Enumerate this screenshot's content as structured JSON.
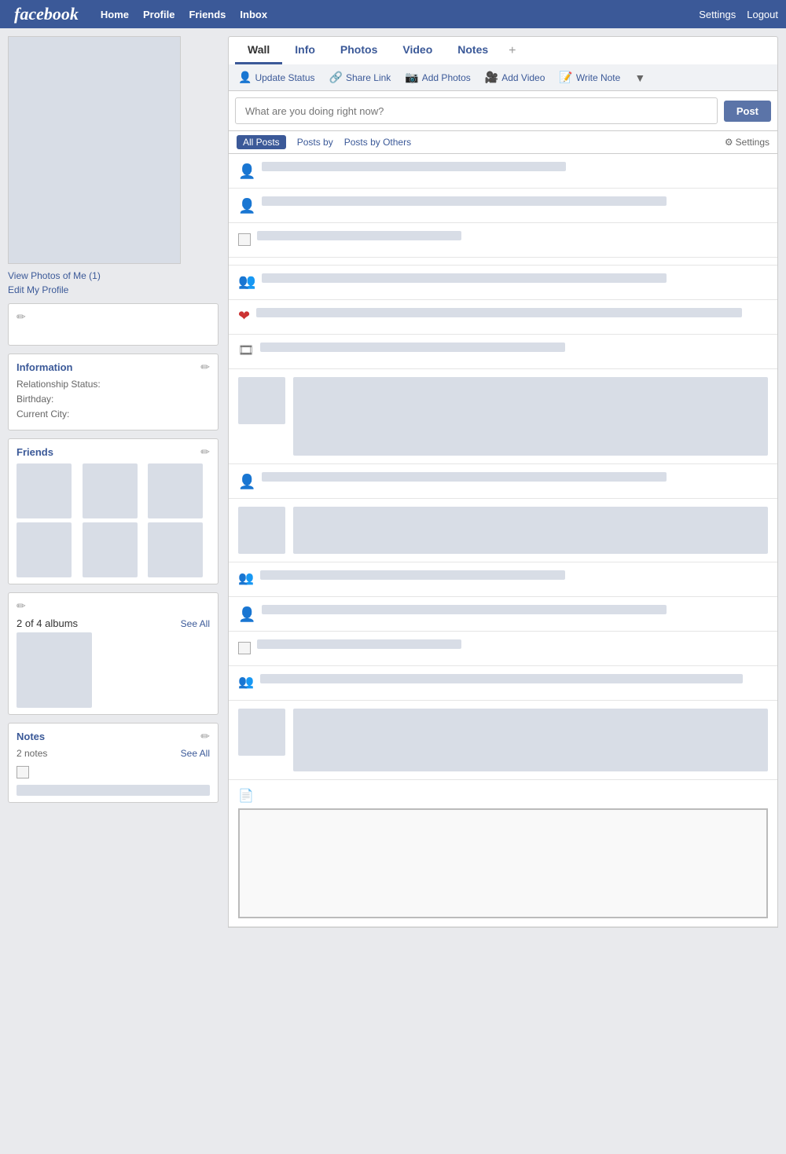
{
  "nav": {
    "logo": "facebook",
    "links": [
      "Home",
      "Profile",
      "Friends",
      "Inbox"
    ],
    "right_links": [
      "Settings",
      "Logout"
    ]
  },
  "sidebar": {
    "view_photos_label": "View Photos of Me (1)",
    "edit_profile_label": "Edit My Profile",
    "information_title": "Information",
    "relationship_label": "Relationship Status:",
    "birthday_label": "Birthday:",
    "city_label": "Current City:",
    "friends_title": "Friends",
    "albums_title": "2 of 4 albums",
    "see_all_label": "See All",
    "notes_title": "Notes",
    "notes_count": "2 notes"
  },
  "tabs": {
    "items": [
      "Wall",
      "Info",
      "Photos",
      "Video",
      "Notes"
    ],
    "active": "Wall"
  },
  "actions": {
    "update_status": "Update Status",
    "share_link": "Share Link",
    "add_photos": "Add Photos",
    "add_video": "Add Video",
    "write_note": "Write Note"
  },
  "post_input": {
    "placeholder": "What are you doing right now?",
    "button_label": "Post"
  },
  "filter": {
    "all_posts": "All Posts",
    "posts_by": "Posts by",
    "posts_by_others": "Posts by Others",
    "settings": "Settings"
  },
  "colors": {
    "facebook_blue": "#3b5998",
    "nav_bg": "#3b5998",
    "post_btn": "#5b74a8"
  }
}
